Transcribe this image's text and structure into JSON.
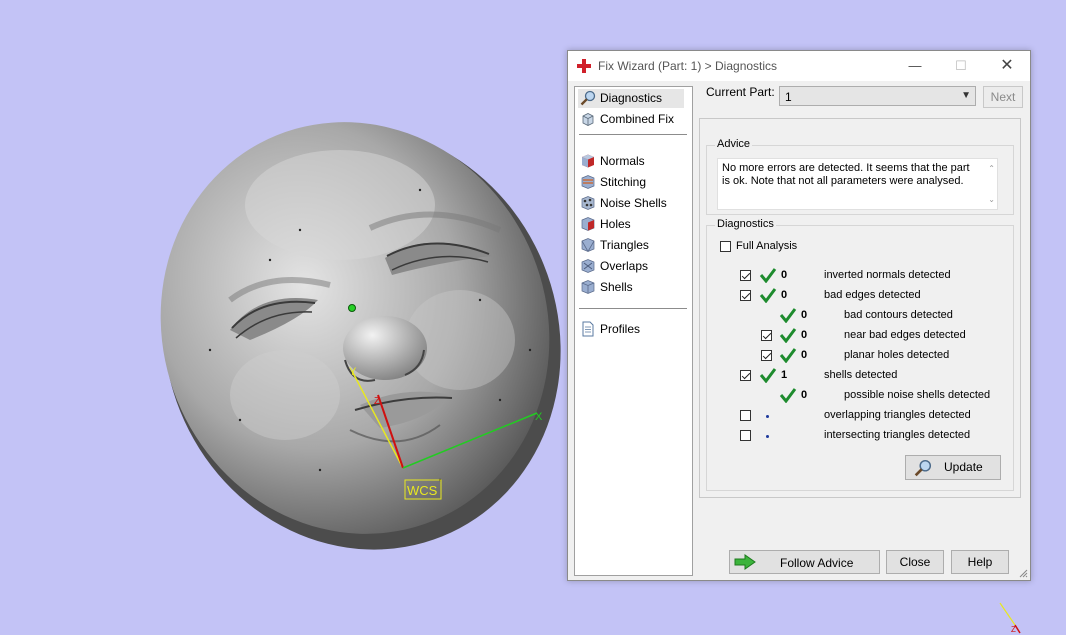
{
  "window": {
    "title": "Fix Wizard (Part: 1) > Diagnostics",
    "min_glyph": "—",
    "max_glyph": "☐",
    "close_glyph": "✕"
  },
  "nav": {
    "items": [
      {
        "label": "Diagnostics",
        "icon": "magnifier-icon",
        "selected": true
      },
      {
        "label": "Combined Fix",
        "icon": "combined-fix-icon"
      },
      {
        "label": "Normals",
        "icon": "normals-cube-icon"
      },
      {
        "label": "Stitching",
        "icon": "stitching-cube-icon"
      },
      {
        "label": "Noise Shells",
        "icon": "noise-shells-icon"
      },
      {
        "label": "Holes",
        "icon": "holes-cube-icon"
      },
      {
        "label": "Triangles",
        "icon": "triangles-cube-icon"
      },
      {
        "label": "Overlaps",
        "icon": "overlaps-cube-icon"
      },
      {
        "label": "Shells",
        "icon": "shells-cube-icon"
      },
      {
        "label": "Profiles",
        "icon": "profiles-document-icon"
      }
    ]
  },
  "current_part": {
    "label": "Current Part:",
    "value": "1",
    "next_label": "Next"
  },
  "advice": {
    "title": "Advice",
    "text": "No more errors are detected. It seems that the part is ok. Note that not all parameters were analysed.",
    "scroll_up": "⌃",
    "scroll_down": "⌄"
  },
  "diagnostics": {
    "title": "Diagnostics",
    "full_analysis_label": "Full Analysis",
    "rows": [
      {
        "checkbox": true,
        "checked": true,
        "status": "ok",
        "count": "0",
        "label": "inverted normals detected",
        "indent": 0
      },
      {
        "checkbox": true,
        "checked": true,
        "status": "ok",
        "count": "0",
        "label": "bad edges detected",
        "indent": 0
      },
      {
        "checkbox": false,
        "status": "ok",
        "count": "0",
        "label": "bad contours detected",
        "indent": 1
      },
      {
        "checkbox": true,
        "checked": true,
        "status": "ok",
        "count": "0",
        "label": "near bad edges detected",
        "indent": 1
      },
      {
        "checkbox": true,
        "checked": true,
        "status": "ok",
        "count": "0",
        "label": "planar holes detected",
        "indent": 1
      },
      {
        "checkbox": true,
        "checked": true,
        "status": "ok",
        "count": "1",
        "label": "shells detected",
        "indent": 0
      },
      {
        "checkbox": false,
        "status": "ok",
        "count": "0",
        "label": "possible noise shells detected",
        "indent": 1
      },
      {
        "checkbox": true,
        "checked": false,
        "status": "pending",
        "count": "",
        "label": "overlapping triangles detected",
        "indent": 0
      },
      {
        "checkbox": true,
        "checked": false,
        "status": "pending",
        "count": "",
        "label": "intersecting triangles detected",
        "indent": 0
      }
    ],
    "update_label": "Update"
  },
  "footer": {
    "follow_advice_label": "Follow Advice",
    "close_label": "Close",
    "help_label": "Help"
  },
  "scene": {
    "wcs_label": "WCS",
    "axis_x": "X",
    "axis_y": "Y",
    "axis_z": "Z",
    "mini_axis_z": "Z",
    "colors": {
      "background": "#c3c3f6",
      "x_axis": "#22cc22",
      "y_axis": "#e8e820",
      "z_axis": "#d01010",
      "check": "#1e8b2e"
    }
  }
}
